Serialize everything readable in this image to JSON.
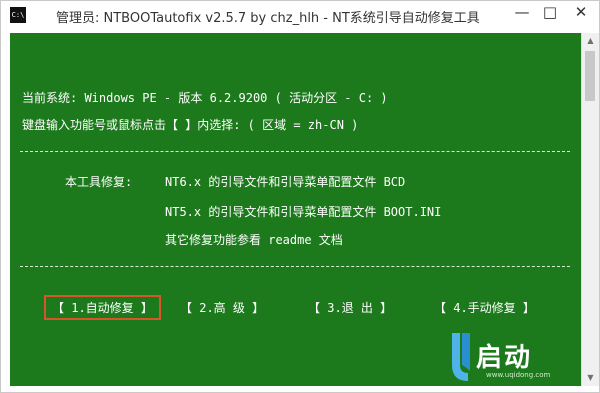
{
  "window": {
    "title": "管理员:  NTBOOTautofix v2.5.7 by chz_hlh - NT系统引导自动修复工具",
    "icon_text": "C:\\",
    "controls": {
      "minimize": "—",
      "maximize": "□",
      "close": "✕"
    }
  },
  "console": {
    "line1": "当前系统: Windows PE - 版本 6.2.9200   ( 活动分区 - C: )",
    "line2": "键盘输入功能号或鼠标点击【 】内选择:          ( 区域 = zh-CN )",
    "divider": "--------------------------------------------------------------------",
    "tool_label": "本工具修复:",
    "fix_nt6": "NT6.x 的引导文件和引导菜单配置文件 BCD",
    "fix_nt5": "NT5.x 的引导文件和引导菜单配置文件 BOOT.INI",
    "readme": "其它修复功能参看 readme 文档",
    "menu": [
      {
        "label": "【 1.自动修复 】"
      },
      {
        "label": "【  2.高  级  】"
      },
      {
        "label": "【  3.退  出  】"
      },
      {
        "label": "【 4.手动修复 】"
      }
    ]
  },
  "watermark": {
    "text": "启动",
    "url": "www.uqidong.com"
  },
  "colors": {
    "console_bg": "#1c7a1c",
    "console_text": "#ffffff",
    "selection_border": "#d8542a"
  },
  "icons": {
    "scroll_up": "triangle-up",
    "scroll_down": "triangle-down"
  }
}
